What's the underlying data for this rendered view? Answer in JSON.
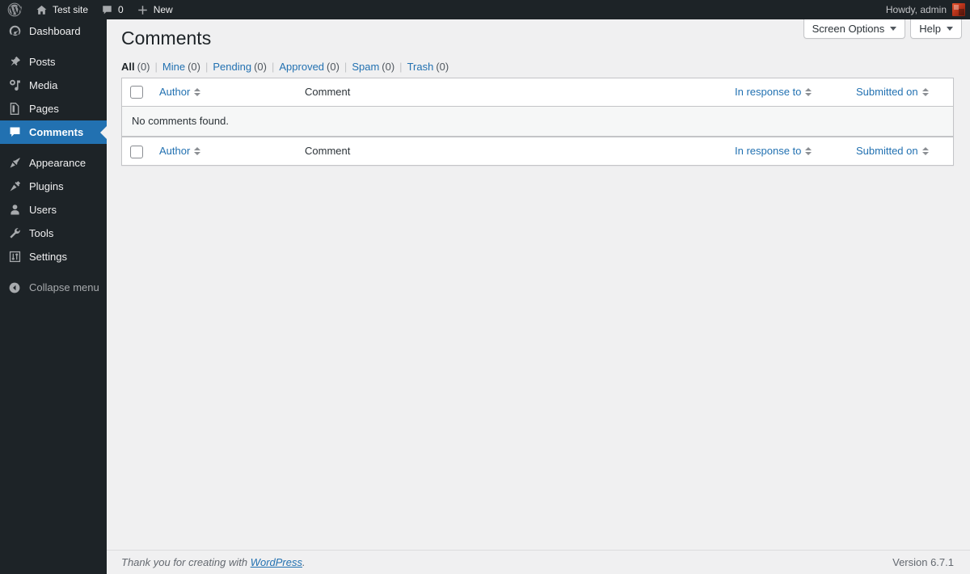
{
  "adminbar": {
    "wp_logo": "wordpress-logo-icon",
    "site_name": "Test site",
    "site_icon": "home-icon",
    "comments_icon": "comment-bubble-icon",
    "comments_count": "0",
    "new_icon": "plus-icon",
    "new_label": "New",
    "howdy": "Howdy, admin",
    "avatar": "user-avatar"
  },
  "sidebar": {
    "items": [
      {
        "label": "Dashboard",
        "icon": "dashboard-icon",
        "current": false
      },
      {
        "label": "Posts",
        "icon": "pin-icon",
        "current": false
      },
      {
        "label": "Media",
        "icon": "media-icon",
        "current": false
      },
      {
        "label": "Pages",
        "icon": "pages-icon",
        "current": false
      },
      {
        "label": "Comments",
        "icon": "comment-bubble-icon",
        "current": true
      },
      {
        "label": "Appearance",
        "icon": "brush-icon",
        "current": false
      },
      {
        "label": "Plugins",
        "icon": "plug-icon",
        "current": false
      },
      {
        "label": "Users",
        "icon": "user-icon",
        "current": false
      },
      {
        "label": "Tools",
        "icon": "wrench-icon",
        "current": false
      },
      {
        "label": "Settings",
        "icon": "settings-sliders-icon",
        "current": false
      }
    ],
    "collapse": {
      "label": "Collapse menu",
      "icon": "arrow-left-circle-icon"
    }
  },
  "screen_meta": {
    "screen_options_label": "Screen Options",
    "help_label": "Help"
  },
  "page": {
    "title": "Comments"
  },
  "filters": [
    {
      "label": "All",
      "count": "(0)",
      "current": true
    },
    {
      "label": "Mine",
      "count": "(0)",
      "current": false
    },
    {
      "label": "Pending",
      "count": "(0)",
      "current": false
    },
    {
      "label": "Approved",
      "count": "(0)",
      "current": false
    },
    {
      "label": "Spam",
      "count": "(0)",
      "current": false
    },
    {
      "label": "Trash",
      "count": "(0)",
      "current": false
    }
  ],
  "table": {
    "columns": {
      "author": "Author",
      "comment": "Comment",
      "response": "In response to",
      "date": "Submitted on"
    },
    "empty_message": "No comments found."
  },
  "footer": {
    "thanks_prefix": "Thank you for creating with ",
    "thanks_link": "WordPress",
    "thanks_suffix": ".",
    "version": "Version 6.7.1"
  },
  "colors": {
    "admin_dark": "#1d2327",
    "accent_blue": "#2271b1",
    "page_bg": "#f0f0f1",
    "link_blue": "#2271b1"
  }
}
